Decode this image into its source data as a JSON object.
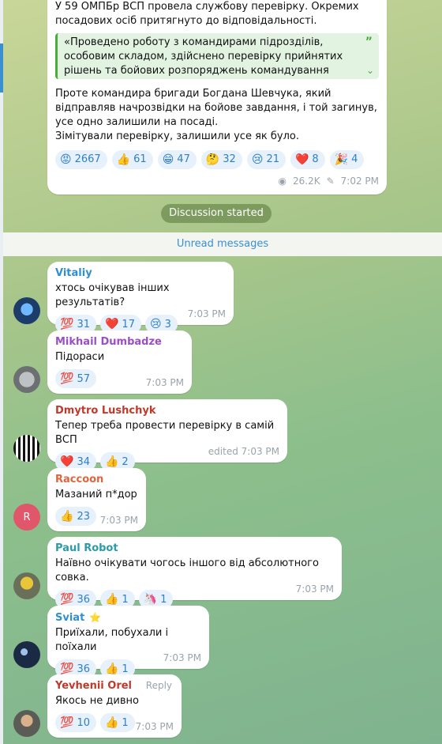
{
  "post": {
    "line1": "У 59 ОМПБр ВСП провела службову перевірку. Окремих",
    "line2": "посадових осіб притягнуто до відповідальності.",
    "quote": "«Проведено роботу з командирами підрозділів, особовим складом, здійснено перевірку прийнятих рішень та бойових розпоряджень командування бригади. Окрім",
    "para2": "Проте командира бригади Богдана Шевчука, який відправляв начрозвідки на бойове завдання, і той загинув, усе одно залишили на посаді.",
    "para3": "Зімітували перевірку, залишили усе як було.",
    "reactions": [
      {
        "emoji": "😡",
        "count": "2667"
      },
      {
        "emoji": "👍",
        "count": "61"
      },
      {
        "emoji": "😁",
        "count": "47"
      },
      {
        "emoji": "🤔",
        "count": "32"
      },
      {
        "emoji": "😢",
        "count": "21"
      },
      {
        "emoji": "❤️",
        "count": "8"
      },
      {
        "emoji": "🎉",
        "count": "4"
      }
    ],
    "views": "26.2K",
    "time": "7:02 PM"
  },
  "service": "Discussion started",
  "unread": "Unread messages",
  "colors": {
    "accent": "#3a8fd0",
    "reaction_bg": "#e6f1fb",
    "quote_border": "#4aac3d"
  },
  "comments": [
    {
      "name": "Vitaliy",
      "color": "#2f8fd0",
      "text": "хтось очікував інших результатів?",
      "reactions": [
        {
          "emoji": "💯",
          "count": "31"
        },
        {
          "emoji": "❤️",
          "count": "17"
        },
        {
          "emoji": "😢",
          "count": "3"
        }
      ],
      "time": "7:03 PM"
    },
    {
      "name": "Mikhail Dumbadze",
      "color": "#9b4fc4",
      "text": "Підораси",
      "reactions": [
        {
          "emoji": "💯",
          "count": "57"
        }
      ],
      "time": "7:03 PM"
    },
    {
      "name": "Dmytro Lushchyk",
      "color": "#c0392b",
      "text": "Тепер треба провести перевірку в самій ВСП",
      "reactions": [
        {
          "emoji": "❤️",
          "count": "34"
        },
        {
          "emoji": "👍",
          "count": "2"
        }
      ],
      "time": "edited 7:03 PM"
    },
    {
      "name": "Raccoon",
      "color": "#e0643d",
      "text": "Мазаний п*дор",
      "reactions": [
        {
          "emoji": "👍",
          "count": "23"
        }
      ],
      "time": "7:03 PM",
      "avatar_letter": "R"
    },
    {
      "name": "Paul Robot",
      "color": "#2a9ba8",
      "text": "Наївно очікувати чогось іншого від абсолютного совка.",
      "reactions": [
        {
          "emoji": "💯",
          "count": "36"
        },
        {
          "emoji": "👍",
          "count": "1"
        },
        {
          "emoji": "🦄",
          "count": "1"
        }
      ],
      "time": "7:03 PM"
    },
    {
      "name": "Sviat",
      "color": "#2f8fd0",
      "badge": "⭐",
      "text": "Приїхали, побухали і поїхали",
      "reactions": [
        {
          "emoji": "💯",
          "count": "36"
        },
        {
          "emoji": "👍",
          "count": "1"
        }
      ],
      "time": "7:03 PM"
    },
    {
      "name": "Yevhenii Orel",
      "color": "#c0392b",
      "reply": "Reply",
      "text": "Якось не дивно",
      "reactions": [
        {
          "emoji": "💯",
          "count": "10"
        },
        {
          "emoji": "👍",
          "count": "1"
        }
      ],
      "time": "7:03 PM"
    }
  ]
}
